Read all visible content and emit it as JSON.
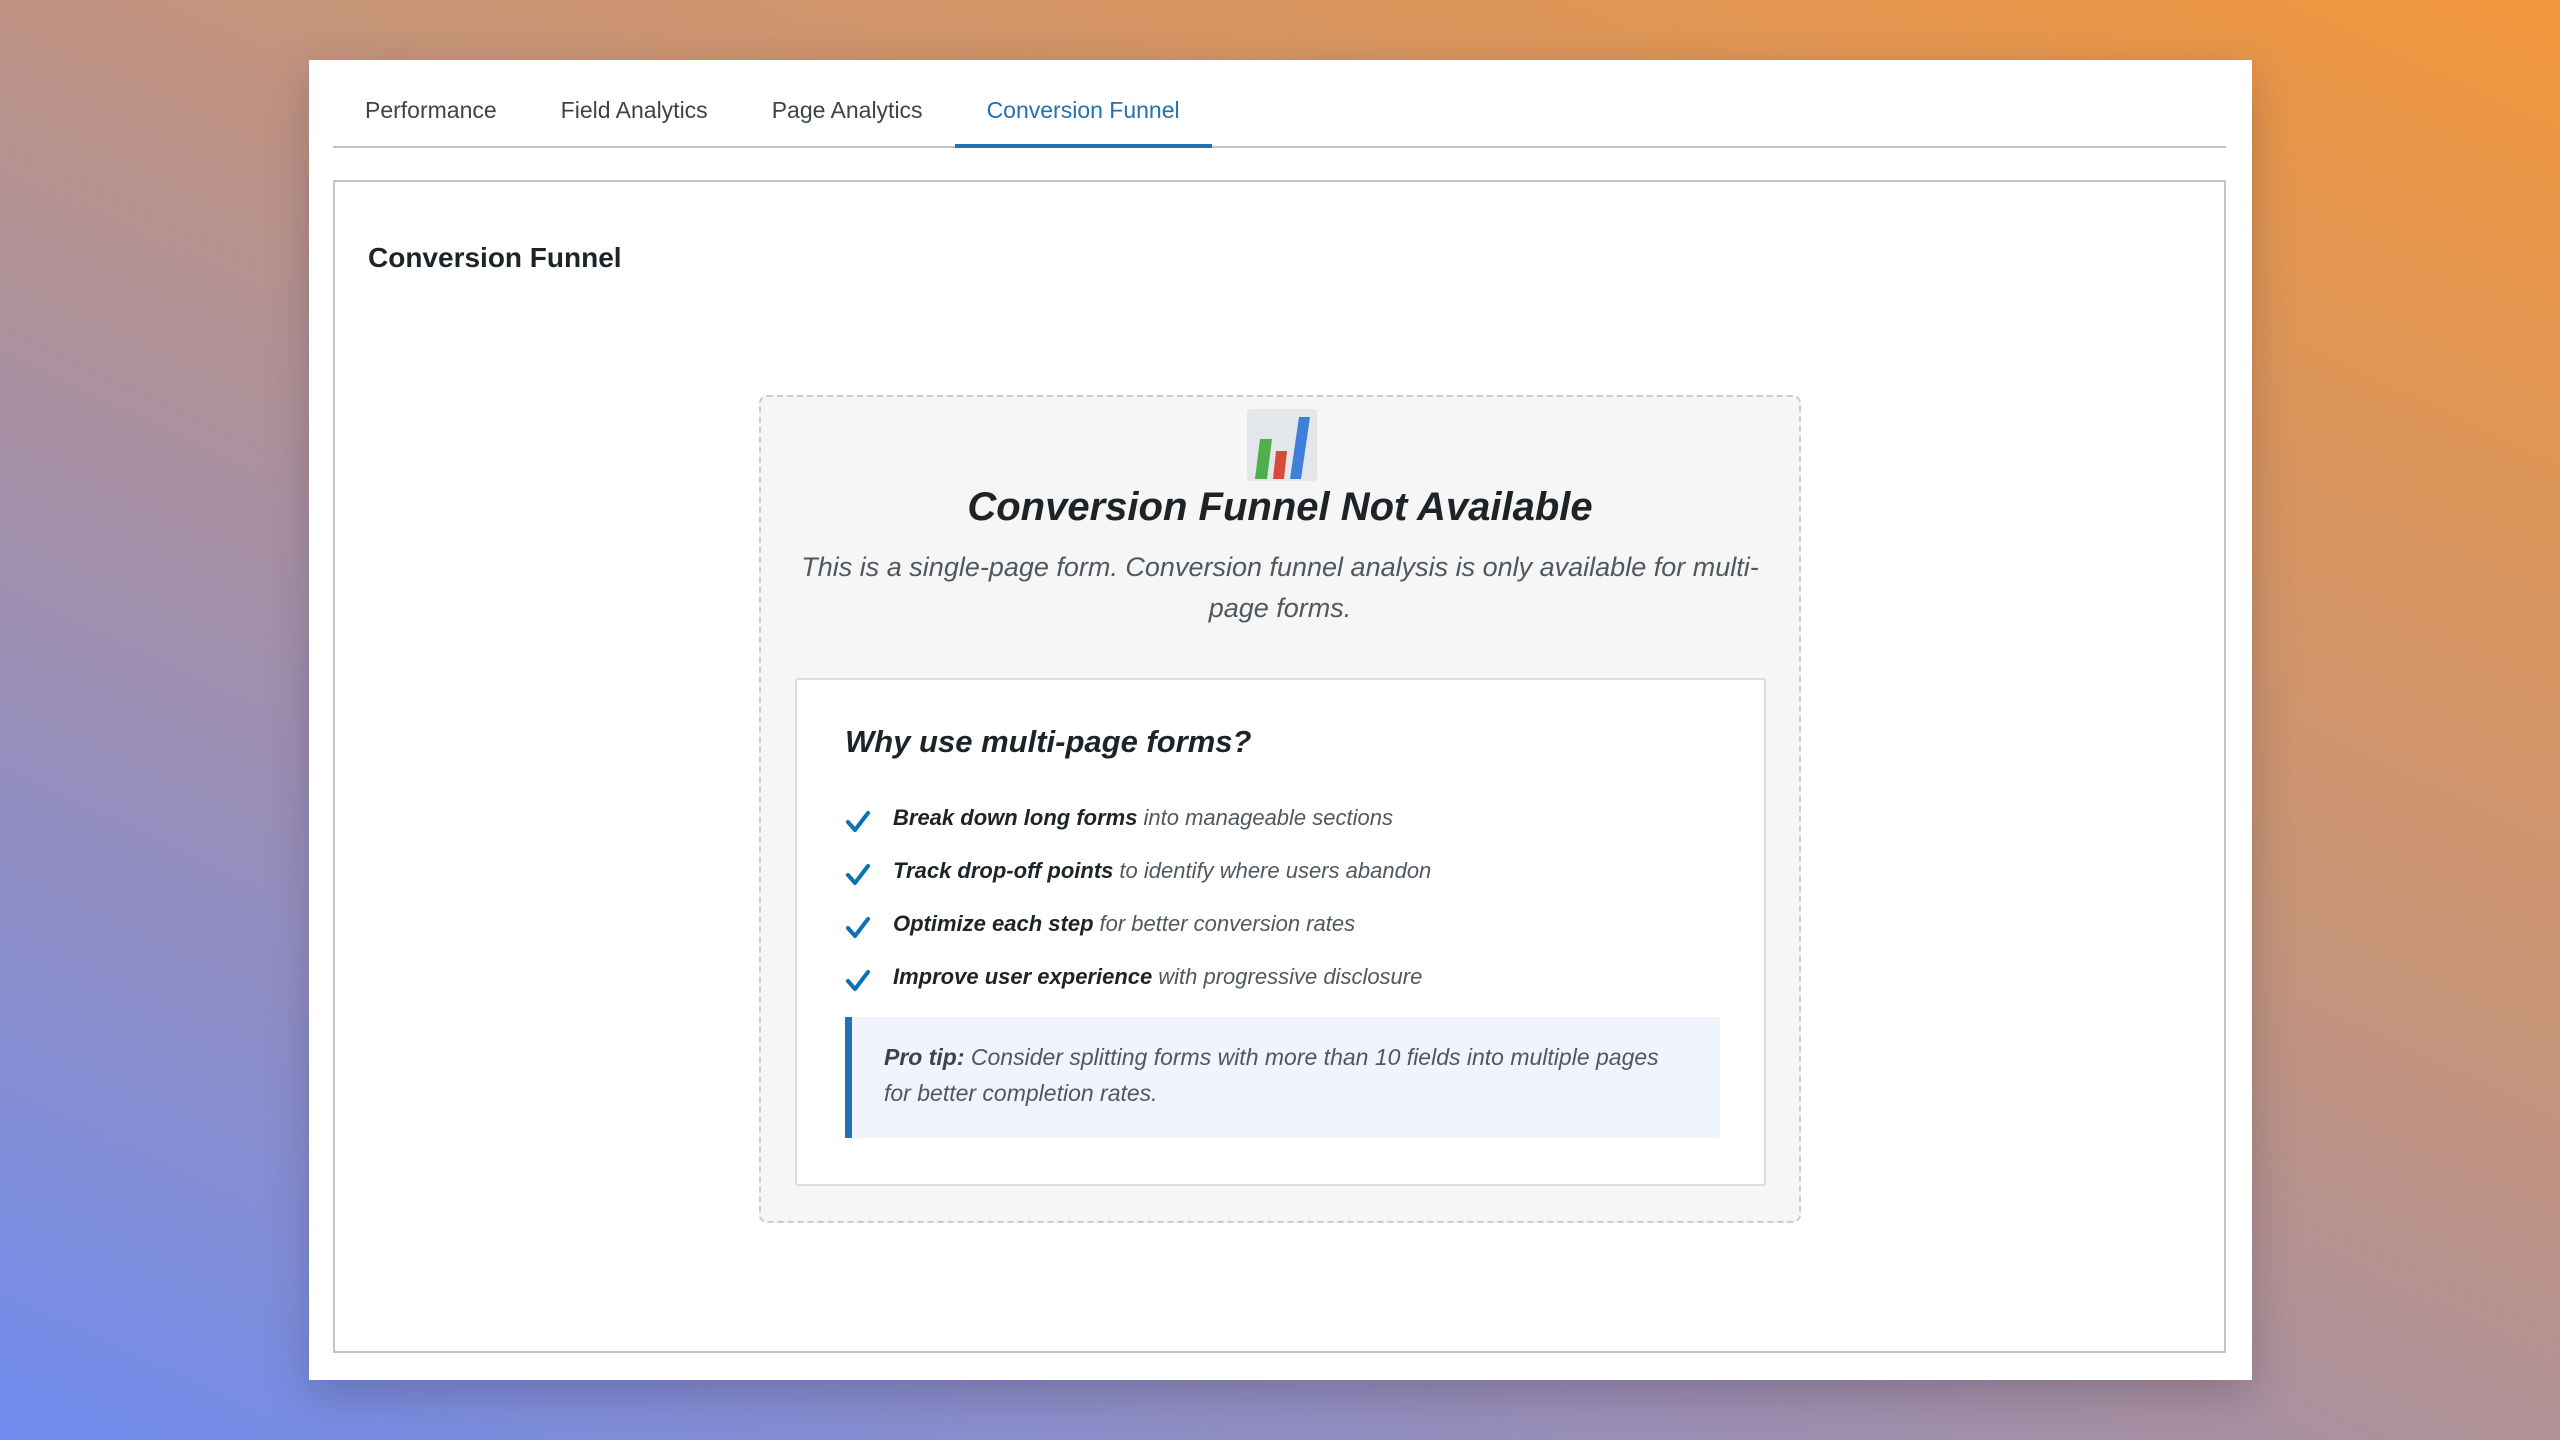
{
  "tabs": [
    {
      "label": "Performance"
    },
    {
      "label": "Field Analytics"
    },
    {
      "label": "Page Analytics"
    },
    {
      "label": "Conversion Funnel"
    }
  ],
  "panel": {
    "title": "Conversion Funnel"
  },
  "empty_state": {
    "icon": "bar-chart-icon",
    "title": "Conversion Funnel Not Available",
    "description": "This is a single-page form. Conversion funnel analysis is only available for multi-page forms."
  },
  "why": {
    "title": "Why use multi-page forms?",
    "benefits": [
      {
        "bold": "Break down long forms",
        "rest": "into manageable sections"
      },
      {
        "bold": "Track drop-off points",
        "rest": "to identify where users abandon"
      },
      {
        "bold": "Optimize each step",
        "rest": "for better conversion rates"
      },
      {
        "bold": "Improve user experience",
        "rest": "with progressive disclosure"
      }
    ],
    "pro_tip": {
      "label": "Pro tip:",
      "text": "Consider splitting forms with more than 10 fields into multiple pages for better completion rates."
    }
  },
  "colors": {
    "accent": "#2271b1",
    "check": "#0a73b3"
  }
}
